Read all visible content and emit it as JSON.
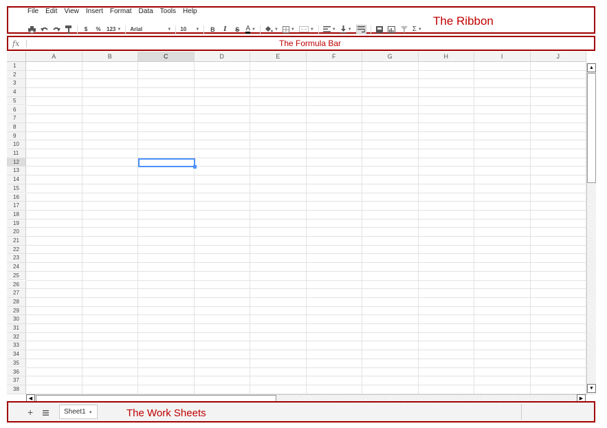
{
  "menubar": {
    "items": [
      "File",
      "Edit",
      "View",
      "Insert",
      "Format",
      "Data",
      "Tools",
      "Help"
    ]
  },
  "toolbar": {
    "currency_label": "$",
    "percent_label": "%",
    "number_format_label": "123",
    "font_family": "Arial",
    "font_size": "10",
    "bold_label": "B",
    "italic_label": "I",
    "strikethrough_label": "S",
    "text_color_label": "A",
    "sum_label": "Σ",
    "icons": [
      "print-icon",
      "undo-icon",
      "redo-icon",
      "paint-format-icon",
      "fill-color-icon",
      "borders-icon",
      "merge-cells-icon",
      "align-icon",
      "valign-icon",
      "wrap-text-icon",
      "insert-comment-icon",
      "insert-chart-icon",
      "filter-icon",
      "functions-icon"
    ]
  },
  "annotations": {
    "ribbon": "The Ribbon",
    "formula_bar": "The Formula Bar",
    "work_sheets": "The Work Sheets"
  },
  "formula_bar": {
    "fx_label": "fx",
    "value": ""
  },
  "grid": {
    "columns": [
      "A",
      "B",
      "C",
      "D",
      "E",
      "F",
      "G",
      "H",
      "I",
      "J"
    ],
    "rows": [
      "1",
      "2",
      "3",
      "4",
      "5",
      "6",
      "7",
      "8",
      "9",
      "10",
      "11",
      "12",
      "13",
      "14",
      "15",
      "16",
      "17",
      "18",
      "19",
      "20",
      "21",
      "22",
      "23",
      "24",
      "25",
      "26",
      "27",
      "28",
      "29",
      "30",
      "31",
      "32",
      "33",
      "34",
      "35",
      "36",
      "37",
      "38"
    ],
    "selected_column": "C",
    "selected_row": "12"
  },
  "sheets": {
    "add_label": "+",
    "tabs": [
      {
        "label": "Sheet1",
        "active": true
      }
    ]
  },
  "colors": {
    "annotation_red": "#c00000",
    "selection_blue": "#4d90fe"
  }
}
